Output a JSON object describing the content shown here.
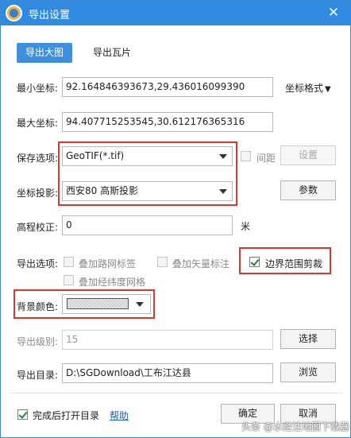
{
  "window": {
    "title": "导出设置",
    "close_glyph": "✕"
  },
  "tabs": [
    {
      "label": "导出大图",
      "active": true
    },
    {
      "label": "导出瓦片",
      "active": false
    }
  ],
  "min_coord": {
    "label": "最小坐标:",
    "value": "92.164846393673,29.436016099390"
  },
  "coord_format": {
    "label": "坐标格式",
    "arrow": "▼"
  },
  "max_coord": {
    "label": "最大坐标:",
    "value": "94.407715253545,30.612176365316"
  },
  "save_option": {
    "label": "保存选项:",
    "value": "GeoTIF(*.tif)"
  },
  "spacing": {
    "label": "间距",
    "checked": false
  },
  "settings_button": {
    "label": "设置"
  },
  "projection": {
    "label": "坐标投影:",
    "value": "西安80 高斯投影"
  },
  "params_button": {
    "label": "参数"
  },
  "elevation": {
    "label": "高程校正:",
    "value": "0",
    "unit": "米"
  },
  "export_options": {
    "label": "导出选项:",
    "road_labels": {
      "label": "叠加路网标签",
      "checked": false
    },
    "vector_labels": {
      "label": "叠加矢量标注",
      "checked": false
    },
    "boundary_clip": {
      "label": "边界范围剪裁",
      "checked": true
    },
    "grid": {
      "label": "叠加经纬度网格",
      "checked": false
    }
  },
  "bg_color": {
    "label": "背景颜色:"
  },
  "export_level": {
    "label": "导出级别:",
    "value": "15"
  },
  "select_button": {
    "label": "选择"
  },
  "export_dir": {
    "label": "导出目录:",
    "value": "D:\\SGDownload\\工布江达县"
  },
  "browse_button": {
    "label": "浏览"
  },
  "open_after": {
    "label": "完成后打开目录",
    "checked": true
  },
  "help_link": {
    "label": "帮助"
  },
  "ok_button": {
    "label": "确定"
  },
  "cancel_button": {
    "label": "取消"
  },
  "watermark": {
    "text": "头条 @水经注地图下载器"
  },
  "colors": {
    "titlebar": "#2f8ae0",
    "highlight": "#e0342f",
    "accent": "#3d8fe0"
  }
}
